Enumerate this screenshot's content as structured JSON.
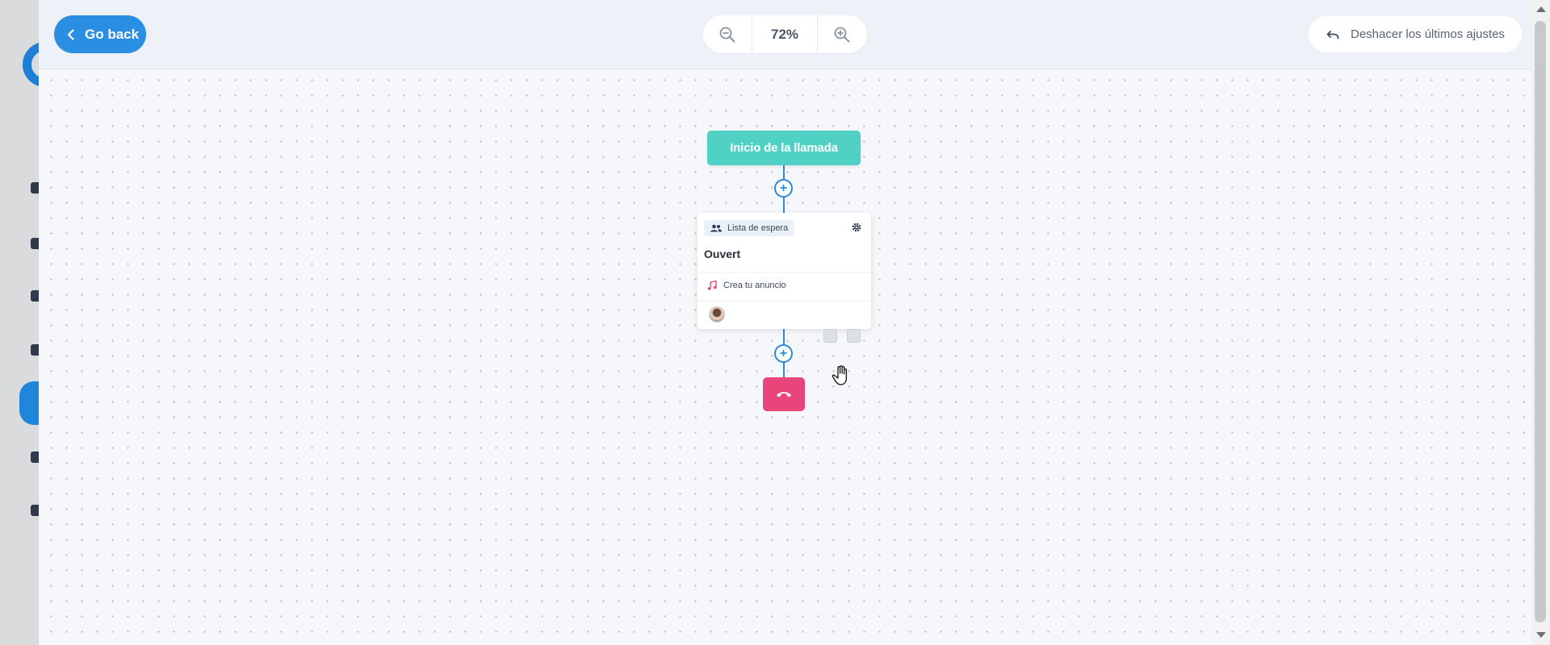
{
  "header": {
    "back_label": "Go back",
    "zoom_value": "72%",
    "undo_label": "Deshacer los últimos ajustes"
  },
  "flow": {
    "start_label": "Inicio de la llamada",
    "queue_node": {
      "tag_label": "Lista de espera",
      "title": "Ouvert",
      "announcement_label": "Crea tu anuncio"
    }
  },
  "colors": {
    "primary": "#2a8ee2",
    "start_node": "#4fd1c5",
    "hangup": "#e8457a",
    "connector": "#2b8ad8"
  }
}
